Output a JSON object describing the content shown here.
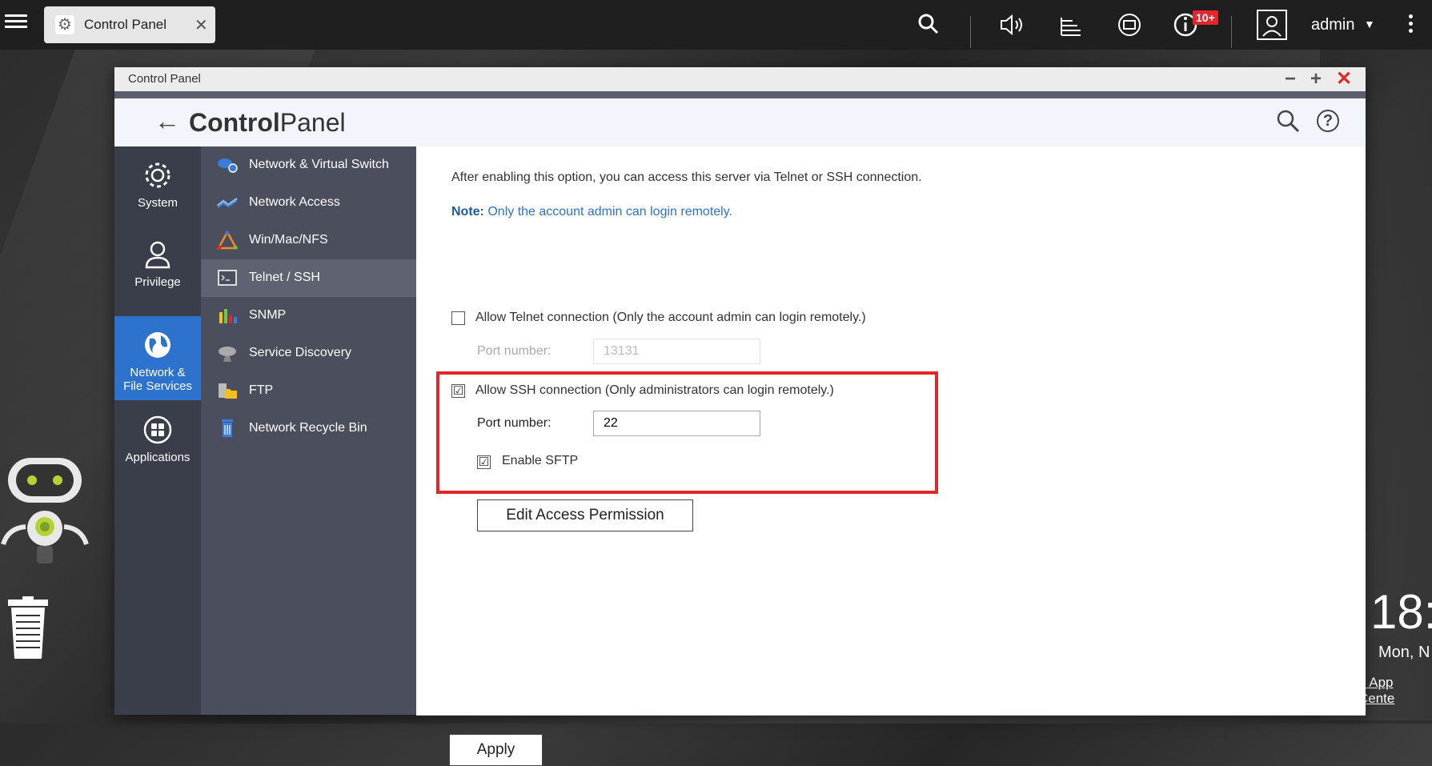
{
  "taskbar": {
    "tab_label": "Control Panel",
    "notification_badge": "10+",
    "user": "admin"
  },
  "window": {
    "title": "Control Panel",
    "app_title_bold": "Control",
    "app_title_light": "Panel"
  },
  "categories": [
    {
      "label": "System",
      "icon": "gear-icon"
    },
    {
      "label": "Privilege",
      "icon": "user-icon"
    },
    {
      "label_line1": "Network &",
      "label_line2": "File Services",
      "icon": "globe-icon",
      "active": true
    },
    {
      "label": "Applications",
      "icon": "grid-icon"
    }
  ],
  "subnav": [
    {
      "label": "Network & Virtual Switch",
      "icon": "network-switch-icon"
    },
    {
      "label": "Network Access",
      "icon": "network-access-icon"
    },
    {
      "label": "Win/Mac/NFS",
      "icon": "win-mac-nfs-icon"
    },
    {
      "label": "Telnet / SSH",
      "icon": "terminal-icon",
      "active": true
    },
    {
      "label": "SNMP",
      "icon": "bar-chart-icon"
    },
    {
      "label": "Service Discovery",
      "icon": "satellite-dish-icon"
    },
    {
      "label": "FTP",
      "icon": "folder-server-icon"
    },
    {
      "label": "Network Recycle Bin",
      "icon": "recycle-bin-icon"
    }
  ],
  "content": {
    "intro": "After enabling this option, you can access this server via Telnet or SSH connection.",
    "note_label": "Note:",
    "note_text": "Only the account admin can login remotely.",
    "telnet": {
      "label": "Allow Telnet connection (Only the account admin can login remotely.)",
      "checked": false,
      "port_label": "Port number:",
      "port_value": "13131"
    },
    "ssh": {
      "label": "Allow SSH connection (Only administrators can login remotely.)",
      "checked": true,
      "port_label": "Port number:",
      "port_value": "22",
      "sftp_label": "Enable SFTP",
      "sftp_checked": true
    },
    "edit_permission_button": "Edit Access Permission",
    "apply_button": "Apply"
  },
  "desktop": {
    "clock": "18:",
    "date": "Mon, N",
    "app_center": "e App Cente"
  },
  "colors": {
    "accent_blue": "#2d72cc",
    "highlight_red": "#e3262c",
    "nav_dark": "#3a3d4a",
    "subnav": "#4b4e5c"
  }
}
